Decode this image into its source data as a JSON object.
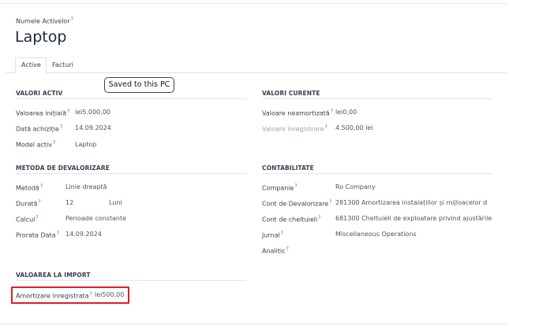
{
  "header": {
    "field_label": "Numele Activelor",
    "title": "Laptop"
  },
  "tabs": [
    {
      "label": "Active"
    },
    {
      "label": "Facturi"
    }
  ],
  "toast": {
    "text": "Saved to this PC"
  },
  "valori_activ": {
    "title": "VALORI ACTIV",
    "rows": [
      {
        "label": "Valoarea inițială",
        "value": "lei5.000,00"
      },
      {
        "label": "Dată achiziție",
        "value": "14.09.2024"
      },
      {
        "label": "Model activ",
        "value": "Laptop"
      }
    ]
  },
  "valori_curente": {
    "title": "VALORI CURENTE",
    "rows": [
      {
        "label": "Valoare neamortizată",
        "value": "lei0,00"
      },
      {
        "label": "Valoare înregistrare",
        "value": "4.500,00 lei"
      }
    ]
  },
  "metoda": {
    "title": "METODA DE DEVALORIZARE",
    "metoda": {
      "label": "Metodă",
      "value": "Linie dreaptă"
    },
    "durata": {
      "label": "Durată",
      "value": "12",
      "unit": "Luni"
    },
    "calcul": {
      "label": "Calcul",
      "value": "Perioade constante"
    },
    "prorata": {
      "label": "Prorata Data",
      "value": "14.09.2024"
    }
  },
  "contabilitate": {
    "title": "CONTABILITATE",
    "rows": [
      {
        "label": "Companie",
        "value": "Ro Company"
      },
      {
        "label": "Cont de Devalorizare",
        "value": "281300 Amortizarea instalațiilor și mijloacelor d"
      },
      {
        "label": "Cont de cheltuieli",
        "value": "681300 Cheltuieli de exploatare privind ajustările"
      },
      {
        "label": "Jurnal",
        "value": "Miscellaneous Operations"
      },
      {
        "label": "Analitic",
        "value": ""
      }
    ]
  },
  "import": {
    "title": "VALOAREA LA IMPORT",
    "label": "Amortizare inregistrata",
    "value": "lei500,00"
  },
  "colors": {
    "accent": "#017e84",
    "highlight": "#e11d2a"
  }
}
